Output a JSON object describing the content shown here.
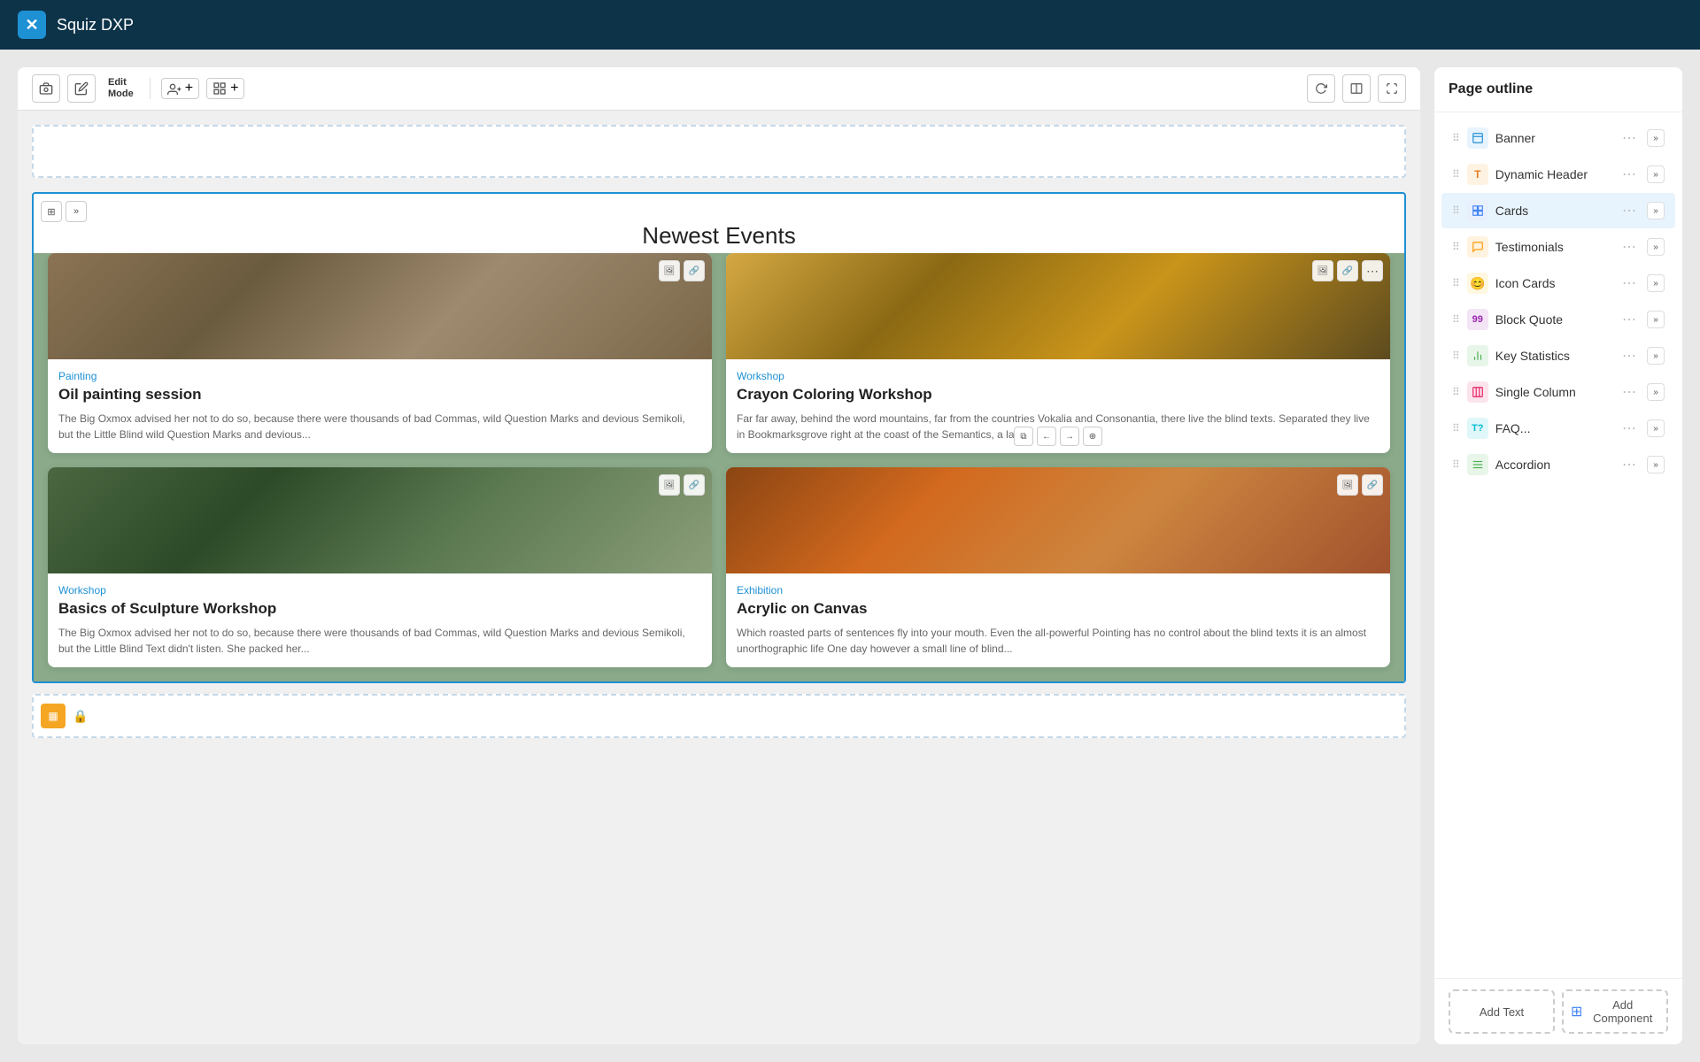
{
  "topbar": {
    "logo_char": "✕",
    "title": "Squiz DXP"
  },
  "toolbar": {
    "edit_mode_line1": "Edit",
    "edit_mode_line2": "Mode",
    "add_users_label": "👥 +",
    "template_label": "⊞ +"
  },
  "content": {
    "cards_title": "Newest Events",
    "cards": [
      {
        "category": "Painting",
        "title": "Oil painting session",
        "text": "The Big Oxmox advised her not to do so, because there were thousands of bad Commas, wild Question Marks and devious Semikoli, but the Little Blind wild Question Marks and devious...",
        "img_type": "painting"
      },
      {
        "category": "Workshop",
        "title": "Crayon Coloring Workshop",
        "text": "Far far away, behind the word mountains, far from the countries Vokalia and Consonantia, there live the blind texts. Separated they live in Bookmarksgrove right at the coast of the Semantics, a larg...",
        "img_type": "workshop"
      },
      {
        "category": "Workshop",
        "title": "Basics of Sculpture Workshop",
        "text": "The Big Oxmox advised her not to do so, because there were thousands of bad Commas, wild Question Marks and devious Semikoli, but the Little Blind Text didn't listen. She packed her...",
        "img_type": "sculpture"
      },
      {
        "category": "Exhibition",
        "title": "Acrylic on Canvas",
        "text": "Which roasted parts of sentences fly into your mouth. Even the all-powerful Pointing has no control about the blind texts it is an almost unorthographic life One day however a small line of blind...",
        "img_type": "canvas"
      }
    ]
  },
  "sidebar": {
    "title": "Page outline",
    "items": [
      {
        "label": "Banner",
        "icon_class": "icon-banner",
        "icon_char": "🖼"
      },
      {
        "label": "Dynamic Header",
        "icon_class": "icon-dynamic-header",
        "icon_char": "T"
      },
      {
        "label": "Cards",
        "icon_class": "icon-cards",
        "icon_char": "⊞",
        "active": true
      },
      {
        "label": "Testimonials",
        "icon_class": "icon-testimonials",
        "icon_char": "💬"
      },
      {
        "label": "Icon Cards",
        "icon_class": "icon-icon-cards",
        "icon_char": "😊"
      },
      {
        "label": "Block Quote",
        "icon_class": "icon-block-quote",
        "icon_char": "99"
      },
      {
        "label": "Key Statistics",
        "icon_class": "icon-key-stats",
        "icon_char": "📊"
      },
      {
        "label": "Single Column",
        "icon_class": "icon-single-col",
        "icon_char": "▦"
      },
      {
        "label": "FAQ...",
        "icon_class": "icon-faq",
        "icon_char": "T?"
      },
      {
        "label": "Accordion",
        "icon_class": "icon-accordion",
        "icon_char": "≡"
      }
    ],
    "add_text_label": "Add Text",
    "add_component_label": "Add Component"
  }
}
